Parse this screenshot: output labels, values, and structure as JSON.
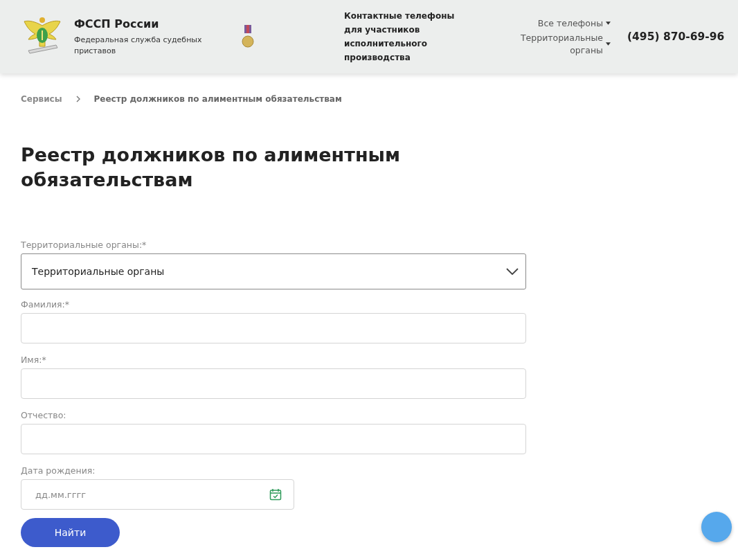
{
  "header": {
    "org_name": "ФССП России",
    "org_subtitle": "Федеральная служба судебных приставов",
    "contacts_title": "Контактные телефоны для участников исполнительного производства",
    "phone_links": [
      {
        "label": "Все телефоны"
      },
      {
        "label": "Территориальные органы"
      }
    ],
    "phone": "(495) 870-69-96"
  },
  "breadcrumbs": [
    {
      "label": "Сервисы",
      "kind": "link"
    },
    {
      "label": "Реестр должников по алиментным обязательствам",
      "kind": "current"
    }
  ],
  "page_title": "Реестр должников по алиментным обязательствам",
  "form": {
    "fields": [
      {
        "kind": "select",
        "label": "Территориальные органы:*",
        "value": "Территориальные органы"
      },
      {
        "kind": "text",
        "label": "Фамилия:*"
      },
      {
        "kind": "text",
        "label": "Имя:*"
      },
      {
        "kind": "text",
        "label": "Отчество:"
      },
      {
        "kind": "date",
        "label": "Дата рождения:",
        "placeholder": "дд.мм.гггг"
      }
    ],
    "submit": "Найти"
  }
}
